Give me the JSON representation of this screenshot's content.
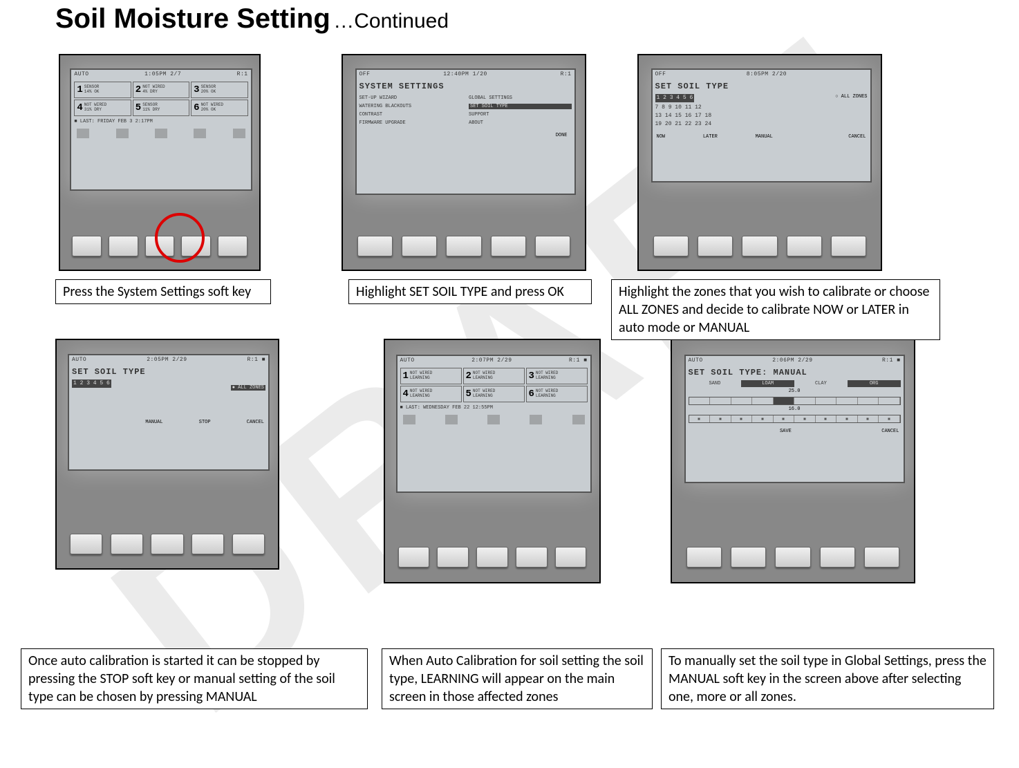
{
  "title": {
    "main": "Soil Moisture Setting",
    "sub": "…Continued"
  },
  "watermark": "DRAFT",
  "captions": {
    "c1": "Press the System Settings soft key",
    "c2": "Highlight SET SOIL TYPE and press OK",
    "c3": "Highlight the zones that you wish to calibrate or choose ALL ZONES and decide to calibrate NOW or LATER in auto mode or MANUAL",
    "c4": "Once auto calibration is started it can be stopped by pressing the STOP soft key or manual setting of the soil type can be chosen by pressing MANUAL",
    "c5": "When Auto Calibration for soil setting the soil type, LEARNING will appear on the main screen in those affected zones",
    "c6": "To manually set the soil type in Global Settings, press the MANUAL soft key in the screen above after selecting one, more or all zones."
  },
  "panel1": {
    "header_left": "AUTO",
    "header_mid": "1:05PM 2/7",
    "header_right": "R:1",
    "zones": [
      {
        "n": "1",
        "l1": "SENSOR",
        "l2": "14% OK"
      },
      {
        "n": "2",
        "l1": "NOT WIRED",
        "l2": "4% DRY"
      },
      {
        "n": "3",
        "l1": "SENSOR",
        "l2": "20% OK"
      },
      {
        "n": "4",
        "l1": "NOT WIRED",
        "l2": "31% DRY"
      },
      {
        "n": "5",
        "l1": "SENSOR",
        "l2": "11% DRY"
      },
      {
        "n": "6",
        "l1": "NOT WIRED",
        "l2": "20% OK"
      }
    ],
    "status": "■ LAST: FRIDAY    FEB 3    2:17PM"
  },
  "panel2": {
    "header_left": "OFF",
    "header_mid": "12:40PM 1/20",
    "header_right": "R:1",
    "lcd_title": "SYSTEM SETTINGS",
    "menu": {
      "r1c1": "SET-UP WIZARD",
      "r1c2": "GLOBAL SETTINGS",
      "r2c1": "WATERING BLACKOUTS",
      "r2c2_hl": "SET SOIL TYPE",
      "r3c1": "CONTRAST",
      "r3c2": "SUPPORT",
      "r4c1": "FIRMWARE UPGRADE",
      "r4c2": "ABOUT"
    },
    "done": "DONE"
  },
  "panel3": {
    "header_left": "OFF",
    "header_mid": "8:05PM 2/20",
    "header_right": "",
    "lcd_title": "SET SOIL TYPE",
    "zone_row1_sel": "1 2 3 4 5 6",
    "zone_row2": "7 8 9 10 11 12",
    "zone_row3": "13 14 15 16 17 18",
    "zone_row4": "19 20 21 22 23 24",
    "all_zones": "○ ALL ZONES",
    "soft": {
      "k1": "NOW",
      "k2": "LATER",
      "k3": "MANUAL",
      "k4": "",
      "k5": "CANCEL"
    }
  },
  "panel4": {
    "header_left": "AUTO",
    "header_mid": "2:05PM 2/29",
    "header_right": "R:1  ■",
    "lcd_title": "SET SOIL TYPE",
    "zone_row1_sel": "1 2 3 4 5 6",
    "all_zones_hl": "● ALL ZONES",
    "soft": {
      "k1": "",
      "k2": "",
      "k3": "MANUAL",
      "k4": "STOP",
      "k5": "CANCEL"
    }
  },
  "panel5": {
    "header_left": "AUTO",
    "header_mid": "2:07PM 2/29",
    "header_right": "R:1  ■",
    "zones": [
      {
        "n": "1",
        "l1": "NOT WIRED",
        "l2": "LEARNING"
      },
      {
        "n": "2",
        "l1": "NOT WIRED",
        "l2": "LEARNING"
      },
      {
        "n": "3",
        "l1": "NOT WIRED",
        "l2": "LEARNING"
      },
      {
        "n": "4",
        "l1": "NOT WIRED",
        "l2": "LEARNING"
      },
      {
        "n": "5",
        "l1": "NOT WIRED",
        "l2": "LEARNING"
      },
      {
        "n": "6",
        "l1": "NOT WIRED",
        "l2": "LEARNING"
      }
    ],
    "status": "■ LAST: WEDNESDAY FEB 22   12:55PM"
  },
  "panel6": {
    "header_left": "AUTO",
    "header_mid": "2:06PM 2/29",
    "header_right": "R:1  ■",
    "lcd_title": "SET SOIL TYPE: MANUAL",
    "segments": {
      "s1": "SAND",
      "s2": "LOAM",
      "s3": "CLAY",
      "s4": "ORG"
    },
    "val_top": "25.0",
    "val_bot": "16.0",
    "soft": {
      "k1": "",
      "k2": "",
      "k3": "SAVE",
      "k4": "",
      "k5": "CANCEL"
    }
  }
}
